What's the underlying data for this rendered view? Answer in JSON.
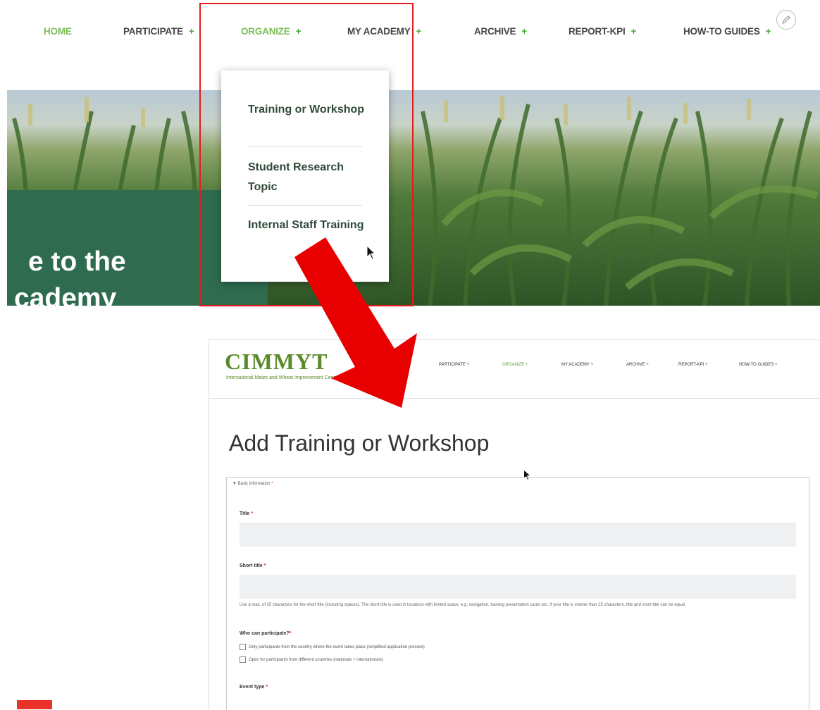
{
  "top": {
    "nav": [
      {
        "label": "HOME",
        "active": true,
        "plus": ""
      },
      {
        "label": "PARTICIPATE",
        "active": false,
        "plus": "+"
      },
      {
        "label": "ORGANIZE",
        "active": true,
        "plus": "+"
      },
      {
        "label": "MY ACADEMY",
        "active": false,
        "plus": "+"
      },
      {
        "label": "ARCHIVE",
        "active": false,
        "plus": "+"
      },
      {
        "label": "REPORT-KPI",
        "active": false,
        "plus": "+"
      },
      {
        "label": "HOW-TO GUIDES",
        "active": false,
        "plus": "+"
      }
    ],
    "hero_line1": "e to the",
    "hero_line2": "cademy",
    "dropdown": [
      "Training or Workshop",
      "Student Research Topic",
      "Internal Staff Training"
    ]
  },
  "bottom": {
    "logo": "CIMMYT",
    "logo_subtitle": "International Maize and Wheat Improvement Center",
    "nav": [
      {
        "label": "PARTICIPATE +",
        "active": false
      },
      {
        "label": "ORGANIZE +",
        "active": true
      },
      {
        "label": "MY ACADEMY +",
        "active": false
      },
      {
        "label": "ARCHIVE +",
        "active": false
      },
      {
        "label": "REPORT-KPI +",
        "active": false
      },
      {
        "label": "HOW-TO GUIDES +",
        "active": false
      }
    ],
    "page_title": "Add Training or Workshop",
    "section_label": "▼ Basic information",
    "required_mark": "*",
    "title_label": "Title",
    "short_title_label": "Short title",
    "short_title_help": "Use a max. of 25 characters for the short title (including spaces). The short title is used in locations with limited space, e.g. navigation, training presentation cards etc. If your title is shorter than 25 characters, title and short title can be equal.",
    "who_label": "Who can participate?",
    "option1": "Only participants from the country where the event takes place (simplified application process)",
    "option2": "Open for participants from different countries (nationals + internationals)",
    "event_type_label": "Event type"
  },
  "colors": {
    "active_nav": "#7bbf55",
    "plus": "#4aa83a",
    "highlight_box": "#e31b1b",
    "arrow": "#e80000",
    "panel_green": "#2e6b4f"
  },
  "icons": [
    "edit-pencil-icon",
    "cursor-icon",
    "arrow-down-right-icon",
    "checkbox-icon"
  ]
}
